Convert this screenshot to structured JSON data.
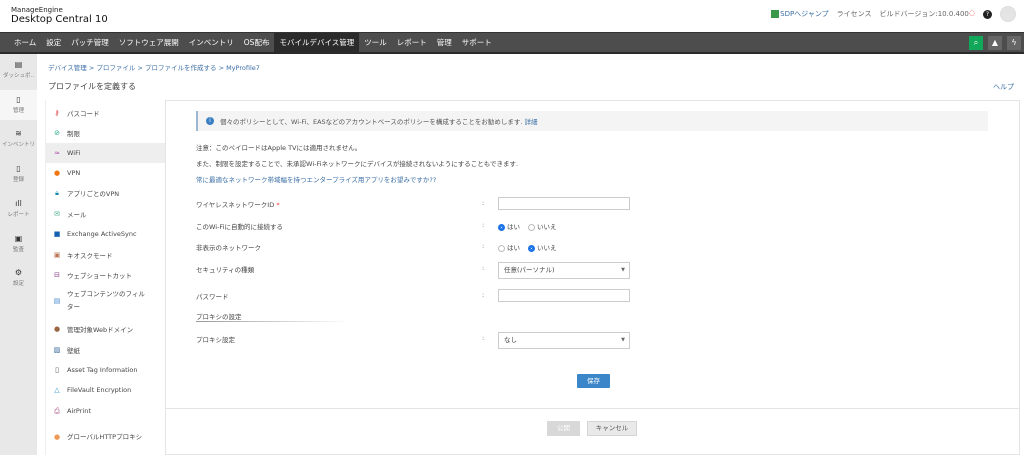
{
  "header": {
    "brand": "ManageEngine",
    "product": "Desktop Central 10",
    "sdp_link": "SDPへジャンプ",
    "license": "ライセンス",
    "build": "ビルドバージョン:10.0.400",
    "help_icon": "question-icon",
    "avatar_icon": "user-icon"
  },
  "nav": {
    "items": [
      "ホーム",
      "設定",
      "パッチ管理",
      "ソフトウェア展開",
      "インベントリ",
      "OS配布",
      "モバイルデバイス管理",
      "ツール",
      "レポート",
      "管理",
      "サポート"
    ],
    "active": "モバイルデバイス管理",
    "accent": "#11a85a"
  },
  "rail": {
    "items": [
      "ダッシュボ..",
      "管理",
      "インベントリ",
      "登録",
      "レポート",
      "監査",
      "設定"
    ]
  },
  "breadcrumb": [
    "デバイス管理 >",
    "プロファイル >",
    "プロファイルを作成する >",
    "MyProfile7"
  ],
  "page": {
    "title": "プロファイルを定義する",
    "help": "ヘルプ"
  },
  "side": {
    "items": [
      "パスコード",
      "制限",
      "WiFi",
      "VPN",
      "アプリごとのVPN",
      "メール",
      "Exchange ActiveSync",
      "キオスクモード",
      "ウェブショートカット",
      "ウェブコンテンツのフィルター",
      "管理対象Webドメイン",
      "壁紙",
      "Asset Tag Information",
      "FileVault Encryption",
      "AirPrint",
      "グローバルHTTPプロキシ"
    ],
    "active": "WiFi"
  },
  "form": {
    "info": "個々のポリシーとして、Wi-Fi、EASなどのアカウントベースのポリシーを構成することをお勧めします.",
    "info_link": "詳細",
    "note1": "注意：このペイロードはApple TVには適用されません。",
    "note2": "また、制限を設定することで、未承認Wi-Fiネットワークにデバイスが接続されないようにすることもできます.",
    "promo_link": "常に最適なネットワーク帯域幅を持つエンタープライズ用アプリをお望みですか??",
    "ssid_label": "ワイヤレスネットワークID",
    "required_mark": "*",
    "colon": ":",
    "auto_join_label": "このWi-Fiに自動的に接続する",
    "hidden_label": "非表示のネットワーク",
    "yes": "はい",
    "no": "いいえ",
    "auto_join_value": "はい",
    "hidden_value": "いいえ",
    "security_label": "セキュリティの種類",
    "security_value": "任意(パーソナル)",
    "password_label": "パスワード",
    "proxy_section": "プロキシの設定",
    "proxy_label": "プロキシ設定",
    "proxy_value": "なし",
    "save": "保存"
  },
  "footer": {
    "publish": "公開",
    "cancel": "キャンセル"
  }
}
